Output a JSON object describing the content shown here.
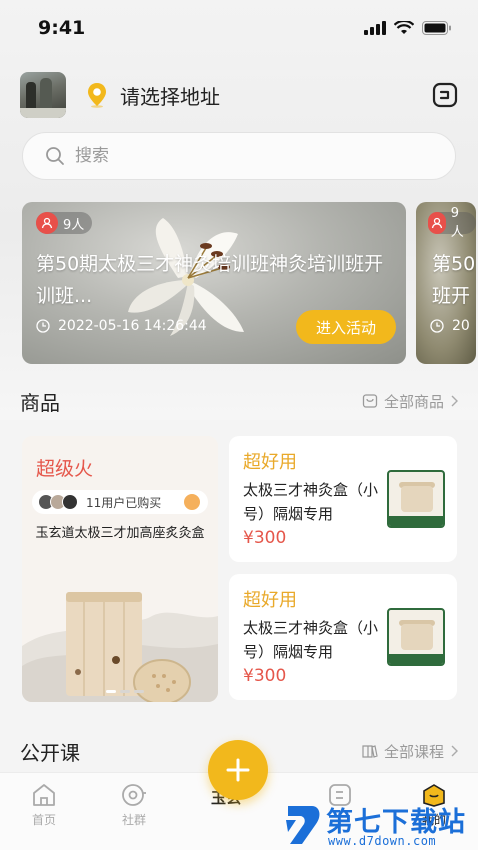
{
  "status_bar": {
    "time": "9:41"
  },
  "header": {
    "location_label": "请选择地址"
  },
  "search": {
    "placeholder": "搜索"
  },
  "banners": [
    {
      "people": "9人",
      "title": "第50期太极三才神灸培训班神灸培训班开训班...",
      "time": "2022-05-16  14:26:44",
      "action": "进入活动"
    },
    {
      "people": "9人",
      "title": "第50",
      "title_line2": "班开",
      "time_partial": "20"
    }
  ],
  "products": {
    "title": "商品",
    "more_label": "全部商品",
    "featured": {
      "tag": "超级火",
      "buyers_text": "11用户已购买",
      "name": "玉玄道太极三才加高座炙灸盒"
    },
    "items": [
      {
        "tag": "超好用",
        "name": "太极三才神灸盒（小号）隔烟专用",
        "price": "¥300"
      },
      {
        "tag": "超好用",
        "name": "太极三才神灸盒（小号）隔烟专用",
        "price": "¥300"
      }
    ]
  },
  "courses": {
    "title": "公开课",
    "more_label": "全部课程"
  },
  "bottom_nav": {
    "home": "首页",
    "community": "社群",
    "center_partial": "玉玄",
    "cart_partial": "",
    "mine_partial": "我的"
  },
  "watermark": {
    "brand": "第七下载站",
    "url": "www.d7down.com"
  },
  "colors": {
    "accent": "#f2b81c",
    "price": "#e5574b",
    "hot_tag": "#e5574b",
    "good_tag": "#e9a92a"
  }
}
